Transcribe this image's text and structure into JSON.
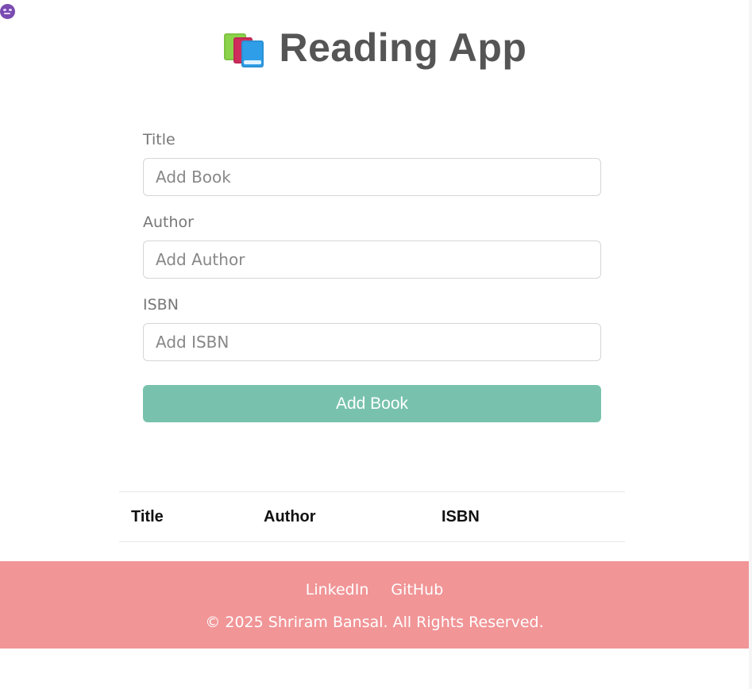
{
  "app": {
    "title": "Reading App",
    "logo_icon": "books-icon"
  },
  "form": {
    "title_label": "Title",
    "title_placeholder": "Add Book",
    "title_value": "",
    "author_label": "Author",
    "author_placeholder": "Add Author",
    "author_value": "",
    "isbn_label": "ISBN",
    "isbn_placeholder": "Add ISBN",
    "isbn_value": "",
    "submit_label": "Add Book"
  },
  "table": {
    "headers": [
      "Title",
      "Author",
      "ISBN"
    ],
    "rows": []
  },
  "footer": {
    "links": [
      "LinkedIn",
      "GitHub"
    ],
    "copyright": "© 2025 Shriram Bansal. All Rights Reserved.",
    "background_color": "#f19597"
  },
  "colors": {
    "accent": "#78c2ad",
    "text_muted": "#777777"
  }
}
